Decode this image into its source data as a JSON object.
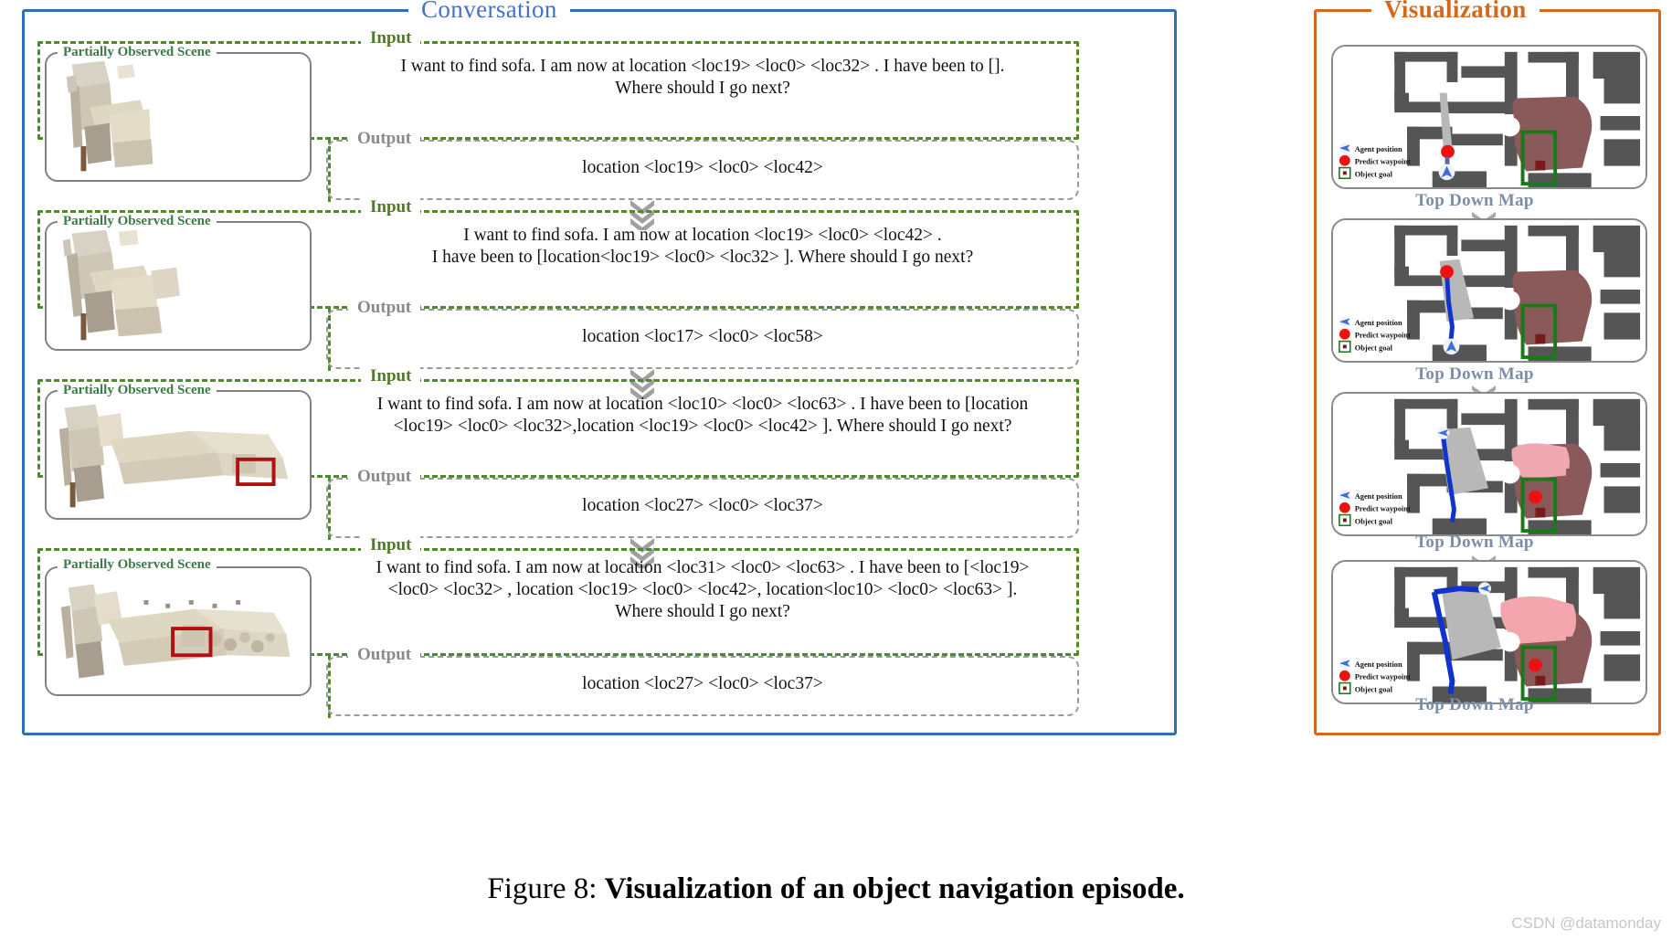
{
  "figure": {
    "caption_number": "Figure 8:",
    "caption_text": "Visualization of an object navigation episode.",
    "watermark": "CSDN @datamonday"
  },
  "conversation": {
    "title": "Conversation",
    "scene_label": "Partially Observed Scene",
    "input_label": "Input",
    "output_label": "Output",
    "turns": [
      {
        "input_line1": "I want to find sofa. I am now at location <loc19>  <loc0>  <loc32> .  I have been to [].",
        "input_line2": "Where should I go next?",
        "input_line3": "",
        "output": "location <loc19>  <loc0>  <loc42>"
      },
      {
        "input_line1": "I want to find sofa. I am now at location <loc19>  <loc0>  <loc42> .",
        "input_line2": "I have been to [location<loc19>  <loc0>  <loc32> ].  Where should I go next?",
        "input_line3": "",
        "output": "location <loc17>  <loc0>  <loc58>"
      },
      {
        "input_line1": "I want to find sofa. I am now at location <loc10>  <loc0>  <loc63> .  I have been to [location",
        "input_line2": "<loc19>  <loc0>  <loc32>,location <loc19>  <loc0>  <loc42> ].  Where should I go next?",
        "input_line3": "",
        "output": "location <loc27>  <loc0>  <loc37>"
      },
      {
        "input_line1": "I want to find sofa. I am now at location <loc31>  <loc0>  <loc63> .   I have been to [<loc19>",
        "input_line2": "<loc0>  <loc32> , location <loc19>  <loc0>  <loc42>, location<loc10>  <loc0>  <loc63> ].",
        "input_line3": "Where should I go next?",
        "output": "location <loc27>  <loc0>  <loc37>"
      }
    ]
  },
  "visualization": {
    "title": "Visualization",
    "map_caption": "Top Down Map",
    "legend": [
      {
        "icon": "agent-arrow-icon",
        "label": "Agent position"
      },
      {
        "icon": "red-dot-icon",
        "label": "Predict waypoint"
      },
      {
        "icon": "green-box-icon",
        "label": "Object goal"
      }
    ],
    "maps": [
      {
        "caption": "Top Down Map"
      },
      {
        "caption": "Top Down Map"
      },
      {
        "caption": "Top Down Map"
      },
      {
        "caption": "Top Down Map"
      }
    ]
  },
  "colors": {
    "conversation_border": "#2f6fba",
    "visualization_border": "#d2691e",
    "input_green": "#4f8a29",
    "output_gray": "#9a9a9a",
    "scene_label_green": "#3b7a47",
    "map_caption": "#7b8fa8",
    "waypoint_red": "#ee1111",
    "goal_green": "#1a7a1a",
    "map_wall": "#555555",
    "map_explored": "#8a5a5a"
  }
}
